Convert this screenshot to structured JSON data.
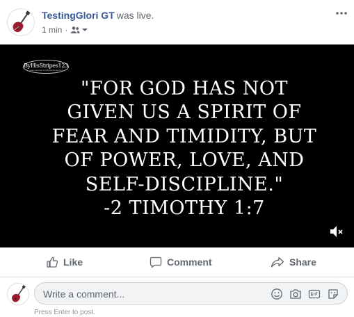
{
  "post": {
    "author": "TestingGlori GT",
    "action": "was live.",
    "time": "1 min",
    "separator": "·",
    "audience_icon": "friends-icon",
    "avatar_icon": "guitar-icon",
    "more_icon": "more-options-icon"
  },
  "video": {
    "channel_badge": "ByHisStripes123",
    "channel_url": "www.youtube.com/ByHisStripes123",
    "verse_lines": [
      "\"For God has not",
      "given us a spirit of",
      "fear and timidity, but",
      "of power, love, and",
      "self-discipline.\"",
      "-2 Timothy 1:7"
    ],
    "mute_icon": "volume-muted-icon"
  },
  "actions": {
    "like": "Like",
    "comment": "Comment",
    "share": "Share"
  },
  "comment_box": {
    "placeholder": "Write a comment...",
    "hint": "Press Enter to post.",
    "icons": [
      "emoji-icon",
      "camera-icon",
      "gif-icon",
      "sticker-icon"
    ]
  },
  "colors": {
    "author_link": "#365899",
    "secondary_text": "#606770",
    "video_background": "#000000",
    "avatar_guitar": "#9b1c2c"
  }
}
